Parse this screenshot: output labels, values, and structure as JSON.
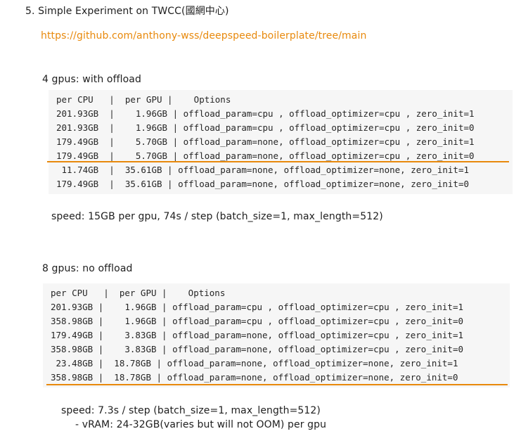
{
  "title": "5. Simple Experiment on TWCC(國網中心)",
  "link": "https://github.com/anthony-wss/deepspeed-boilerplate/tree/main",
  "section1": {
    "heading": "4 gpus: with offload",
    "lines": [
      "per CPU   |  per GPU |    Options",
      "201.93GB  |    1.96GB | offload_param=cpu , offload_optimizer=cpu , zero_init=1",
      "201.93GB  |    1.96GB | offload_param=cpu , offload_optimizer=cpu , zero_init=0",
      "179.49GB  |    5.70GB | offload_param=none, offload_optimizer=cpu , zero_init=1",
      "179.49GB  |    5.70GB | offload_param=none, offload_optimizer=cpu , zero_init=0",
      " 11.74GB  |  35.61GB | offload_param=none, offload_optimizer=none, zero_init=1",
      "179.49GB  |  35.61GB | offload_param=none, offload_optimizer=none, zero_init=0"
    ],
    "speed": "speed: 15GB per gpu, 74s / step (batch_size=1, max_length=512)"
  },
  "section2": {
    "heading": "8 gpus: no offload",
    "lines": [
      "per CPU   |  per GPU |    Options",
      "201.93GB |    1.96GB | offload_param=cpu , offload_optimizer=cpu , zero_init=1",
      "358.98GB |    1.96GB | offload_param=cpu , offload_optimizer=cpu , zero_init=0",
      "179.49GB |    3.83GB | offload_param=none, offload_optimizer=cpu , zero_init=1",
      "358.98GB |    3.83GB | offload_param=none, offload_optimizer=cpu , zero_init=0",
      " 23.48GB |  18.78GB | offload_param=none, offload_optimizer=none, zero_init=1",
      "358.98GB |  18.78GB | offload_param=none, offload_optimizer=none, zero_init=0"
    ],
    "speed": "speed: 7.3s / step (batch_size=1, max_length=512)",
    "note": "- vRAM: 24-32GB(varies but will not OOM) per gpu"
  },
  "colors": {
    "accent": "#e8890c",
    "code_bg": "#f6f6f6"
  }
}
